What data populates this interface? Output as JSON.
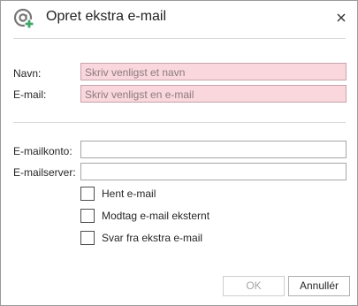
{
  "dialog": {
    "title": "Opret ekstra e-mail",
    "close_label": "Luk"
  },
  "fields": {
    "name": {
      "label": "Navn:",
      "placeholder": "Skriv venligst et navn"
    },
    "email": {
      "label": "E-mail:",
      "placeholder": "Skriv venligst en e-mail"
    },
    "account": {
      "label": "E-mailkonto:",
      "value": ""
    },
    "server": {
      "label": "E-mailserver:",
      "value": ""
    }
  },
  "checkboxes": [
    {
      "label": "Hent e-mail",
      "checked": false
    },
    {
      "label": "Modtag e-mail eksternt",
      "checked": false
    },
    {
      "label": "Svar fra ekstra e-mail",
      "checked": false
    }
  ],
  "buttons": {
    "ok": {
      "label": "OK",
      "enabled": false
    },
    "cancel": {
      "label": "Annullér",
      "enabled": true
    }
  },
  "icons": {
    "app": "at-sign-plus-icon",
    "close": "close-icon"
  },
  "colors": {
    "required_field_bg": "#f9d7dc",
    "icon_gray": "#777777",
    "icon_accent": "#3fa66a"
  }
}
